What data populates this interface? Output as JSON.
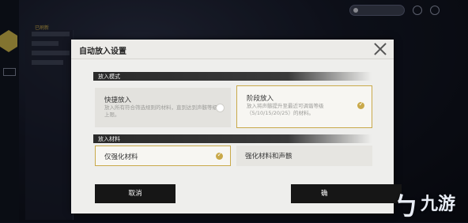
{
  "background": {
    "panel_title": "已刷新",
    "top_pill_text": "",
    "colors": {
      "accent_gold": "#c9a94a",
      "dark": "#161616"
    }
  },
  "dialog": {
    "title": "自动放入设置",
    "sections": {
      "mode": {
        "label": "放入模式"
      },
      "material": {
        "label": "放入材料"
      }
    },
    "mode_options": [
      {
        "title": "快捷放入",
        "desc": "放入所有符合筛选规则的材料，直到达到声骸等级上限。",
        "selected": false
      },
      {
        "title": "阶段放入",
        "desc": "放入将声骸提升至最近可调谐等级（5/10/15/20/25）的材料。",
        "selected": true
      }
    ],
    "material_options": [
      {
        "label": "仅强化材料",
        "selected": true
      },
      {
        "label": "强化材料和声骸",
        "selected": false
      }
    ],
    "cancel_label": "取消",
    "confirm_label": "确"
  },
  "watermark": {
    "glyph": "ㄅ",
    "text": "九游"
  },
  "icons": [
    "close-icon",
    "check-icon",
    "hex-badge-icon"
  ]
}
